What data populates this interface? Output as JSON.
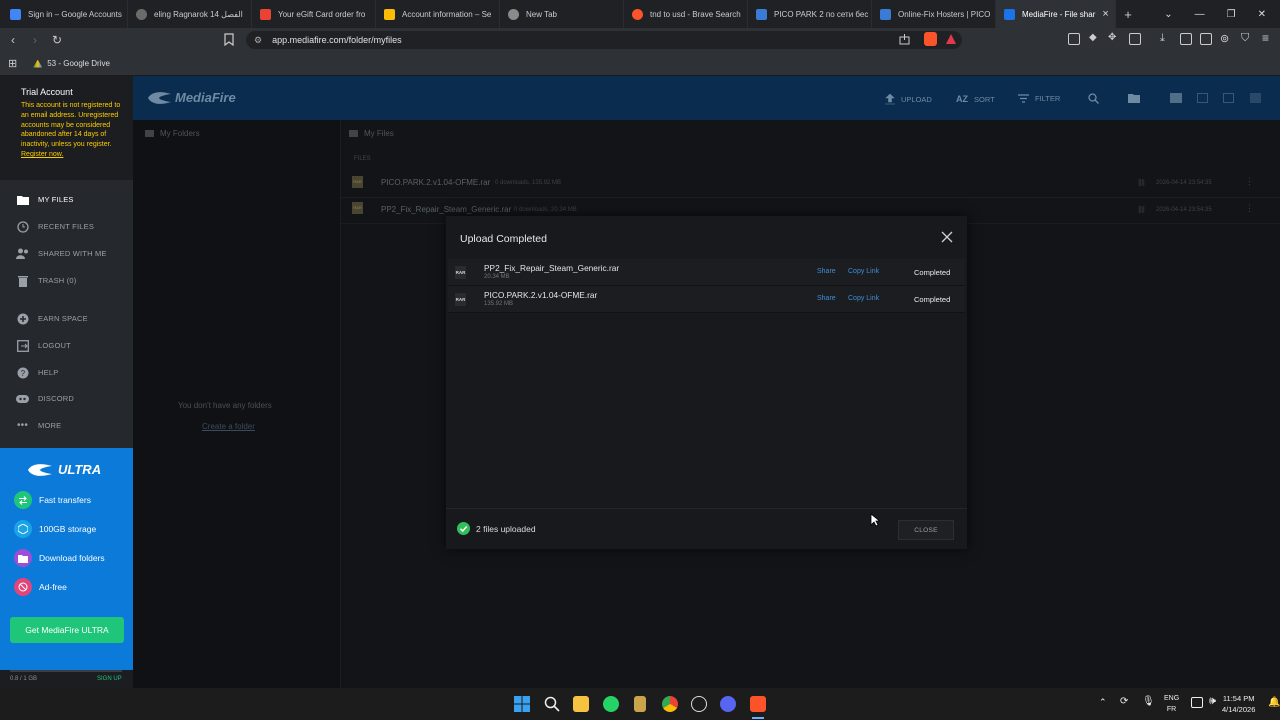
{
  "browser": {
    "tabs": [
      {
        "title": "Sign in – Google Accounts",
        "color": "#4285f4"
      },
      {
        "title": "eling Ragnarok 14 الفصل",
        "color": "#6b6b6b"
      },
      {
        "title": "Your eGift Card order fro",
        "color": "#ea4335"
      },
      {
        "title": "Account information – Se",
        "color": "#fbbc05"
      },
      {
        "title": "New Tab",
        "color": "#8a8a8a"
      },
      {
        "title": "tnd to usd - Brave Search",
        "color": "#fb542b"
      },
      {
        "title": "PICO PARK 2 по сети бес",
        "color": "#3a7bd5"
      },
      {
        "title": "Online-Fix Hosters | PICO",
        "color": "#3a7bd5"
      },
      {
        "title": "MediaFire - File shar",
        "color": "#1a73e8",
        "active": true
      }
    ],
    "url": "app.mediafire.com/folder/myfiles",
    "bookmark": "53 - Google Drive"
  },
  "sidebar": {
    "trial_title": "Trial Account",
    "trial_text": "This account is not registered to an email address. Unregistered accounts may be considered abandoned after 14 days of inactivity, unless you register.",
    "register_link": "Register now.",
    "items": [
      {
        "label": "MY FILES",
        "icon": "file-icon"
      },
      {
        "label": "RECENT FILES",
        "icon": "clock-icon"
      },
      {
        "label": "SHARED WITH ME",
        "icon": "people-icon"
      },
      {
        "label": "TRASH (0)",
        "icon": "trash-icon"
      },
      {
        "label": "EARN SPACE",
        "icon": "plus-circle-icon"
      },
      {
        "label": "LOGOUT",
        "icon": "logout-icon"
      },
      {
        "label": "HELP",
        "icon": "help-icon"
      },
      {
        "label": "DISCORD",
        "icon": "discord-icon"
      },
      {
        "label": "MORE",
        "icon": "more-icon"
      }
    ],
    "ultra": {
      "brand": "ULTRA",
      "features": [
        "Fast transfers",
        "100GB storage",
        "Download folders",
        "Ad-free"
      ],
      "cta": "Get MediaFire ULTRA"
    },
    "storage_used": "0.8 / 1 GB",
    "signup": "SIGN UP"
  },
  "header": {
    "logo": "MediaFire",
    "upload": "UPLOAD",
    "sort": "SORT",
    "filter": "FILTER"
  },
  "main": {
    "folders_title": "My Folders",
    "files_title": "My Files",
    "files_label": "FILES",
    "no_folders": "You don't have any folders",
    "create_folder": "Create a folder",
    "files": [
      {
        "name": "PICO.PARK.2.v1.04-OFME.rar",
        "meta": "0 downloads, 135.92 MB",
        "date": "2026-04-14 23:54:35"
      },
      {
        "name": "PP2_Fix_Repair_Steam_Generic.rar",
        "meta": "0 downloads, 20.34 MB",
        "date": "2026-04-14 23:54:35"
      }
    ]
  },
  "modal": {
    "title": "Upload Completed",
    "rows": [
      {
        "name": "PP2_Fix_Repair_Steam_Generic.rar",
        "size": "20.34 MB",
        "share": "Share",
        "copy": "Copy Link",
        "status": "Completed"
      },
      {
        "name": "PICO.PARK.2.v1.04-OFME.rar",
        "size": "135.92 MB",
        "share": "Share",
        "copy": "Copy Link",
        "status": "Completed"
      }
    ],
    "footer_text": "2 files uploaded",
    "close_label": "CLOSE"
  },
  "taskbar": {
    "lang_top": "ENG",
    "lang_bottom": "FR",
    "time": "11:54 PM",
    "date": "4/14/2026"
  }
}
